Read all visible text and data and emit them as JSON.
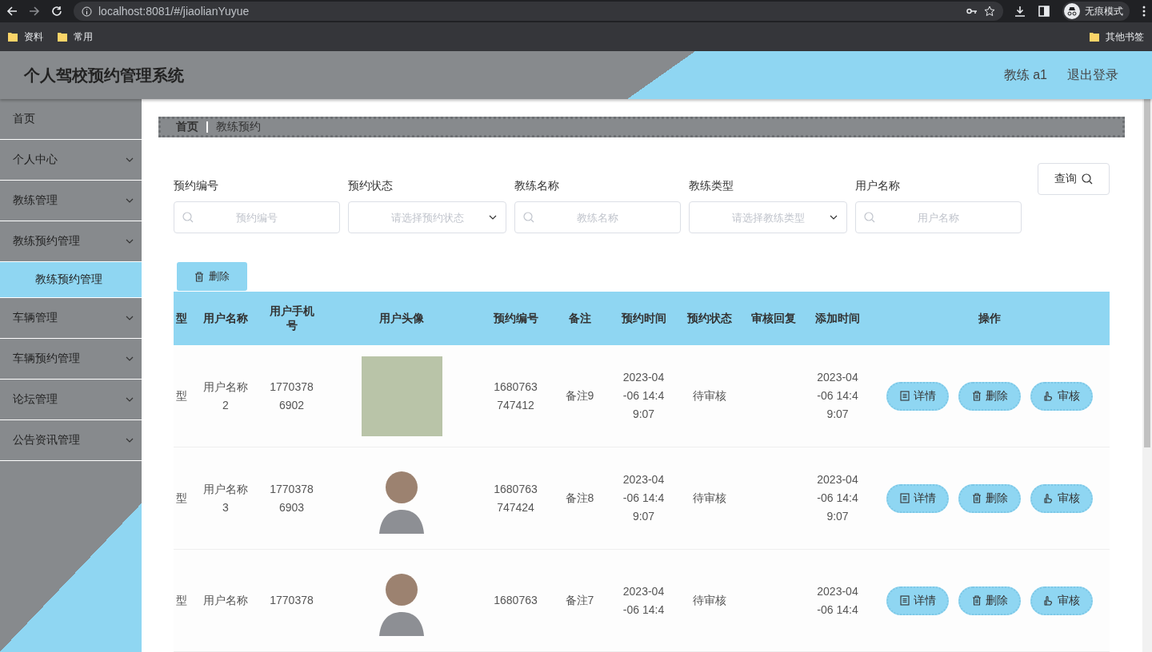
{
  "browser": {
    "url": "localhost:8081/#/jiaolianYuyue",
    "profile_label": "无痕模式",
    "bookmarks": [
      "资料",
      "常用"
    ],
    "other_bookmarks": "其他书签"
  },
  "header": {
    "title": "个人驾校预约管理系统",
    "user": "教练 a1",
    "logout": "退出登录"
  },
  "sidebar": {
    "items": [
      {
        "label": "首页",
        "expandable": false
      },
      {
        "label": "个人中心",
        "expandable": true
      },
      {
        "label": "教练管理",
        "expandable": true
      },
      {
        "label": "教练预约管理",
        "expandable": true,
        "children": [
          {
            "label": "教练预约管理",
            "selected": true
          }
        ]
      },
      {
        "label": "车辆管理",
        "expandable": true
      },
      {
        "label": "车辆预约管理",
        "expandable": true
      },
      {
        "label": "论坛管理",
        "expandable": true
      },
      {
        "label": "公告资讯管理",
        "expandable": true
      }
    ]
  },
  "breadcrumb": [
    "首页",
    "教练预约"
  ],
  "filters": [
    {
      "kind": "text",
      "label": "预约编号",
      "placeholder": "预约编号"
    },
    {
      "kind": "select",
      "label": "预约状态",
      "placeholder": "请选择预约状态"
    },
    {
      "kind": "text",
      "label": "教练名称",
      "placeholder": "教练名称"
    },
    {
      "kind": "select",
      "label": "教练类型",
      "placeholder": "请选择教练类型"
    },
    {
      "kind": "text",
      "label": "用户名称",
      "placeholder": "用户名称"
    }
  ],
  "query_button": "查询",
  "delete_button": "删除",
  "table": {
    "columns": [
      "型",
      "用户名称",
      "用户手机号",
      "用户头像",
      "预约编号",
      "备注",
      "预约时间",
      "预约状态",
      "审核回复",
      "添加时间",
      "操作"
    ],
    "rows": [
      {
        "column_1": "型",
        "user_name": "用户名称2",
        "phone": "17703786902",
        "kind": "photo",
        "booking_no": "1680763747412",
        "note": "备注9",
        "booking_time": "2023-04-06 14:49:07",
        "status": "待审核",
        "added_time": "2023-04-06 14:49:07",
        "actions": [
          "详情",
          "删除",
          "审核"
        ]
      },
      {
        "column_1": "型",
        "user_name": "用户名称3",
        "phone": "17703786903",
        "kind": "cartoon",
        "booking_no": "1680763747424",
        "note": "备注8",
        "booking_time": "2023-04-06 14:49:07",
        "status": "待审核",
        "added_time": "2023-04-06 14:49:07",
        "actions": [
          "详情",
          "删除",
          "审核"
        ]
      },
      {
        "column_1": "型",
        "user_name": "用户名称",
        "phone": "1770378",
        "kind": "cartoon",
        "booking_no": "1680763",
        "note": "备注7",
        "booking_time": "2023-04-06 14:4",
        "status": "待审核",
        "added_time": "2023-04-06 14:4",
        "actions": [
          "详情",
          "删除",
          "审核"
        ]
      }
    ]
  }
}
